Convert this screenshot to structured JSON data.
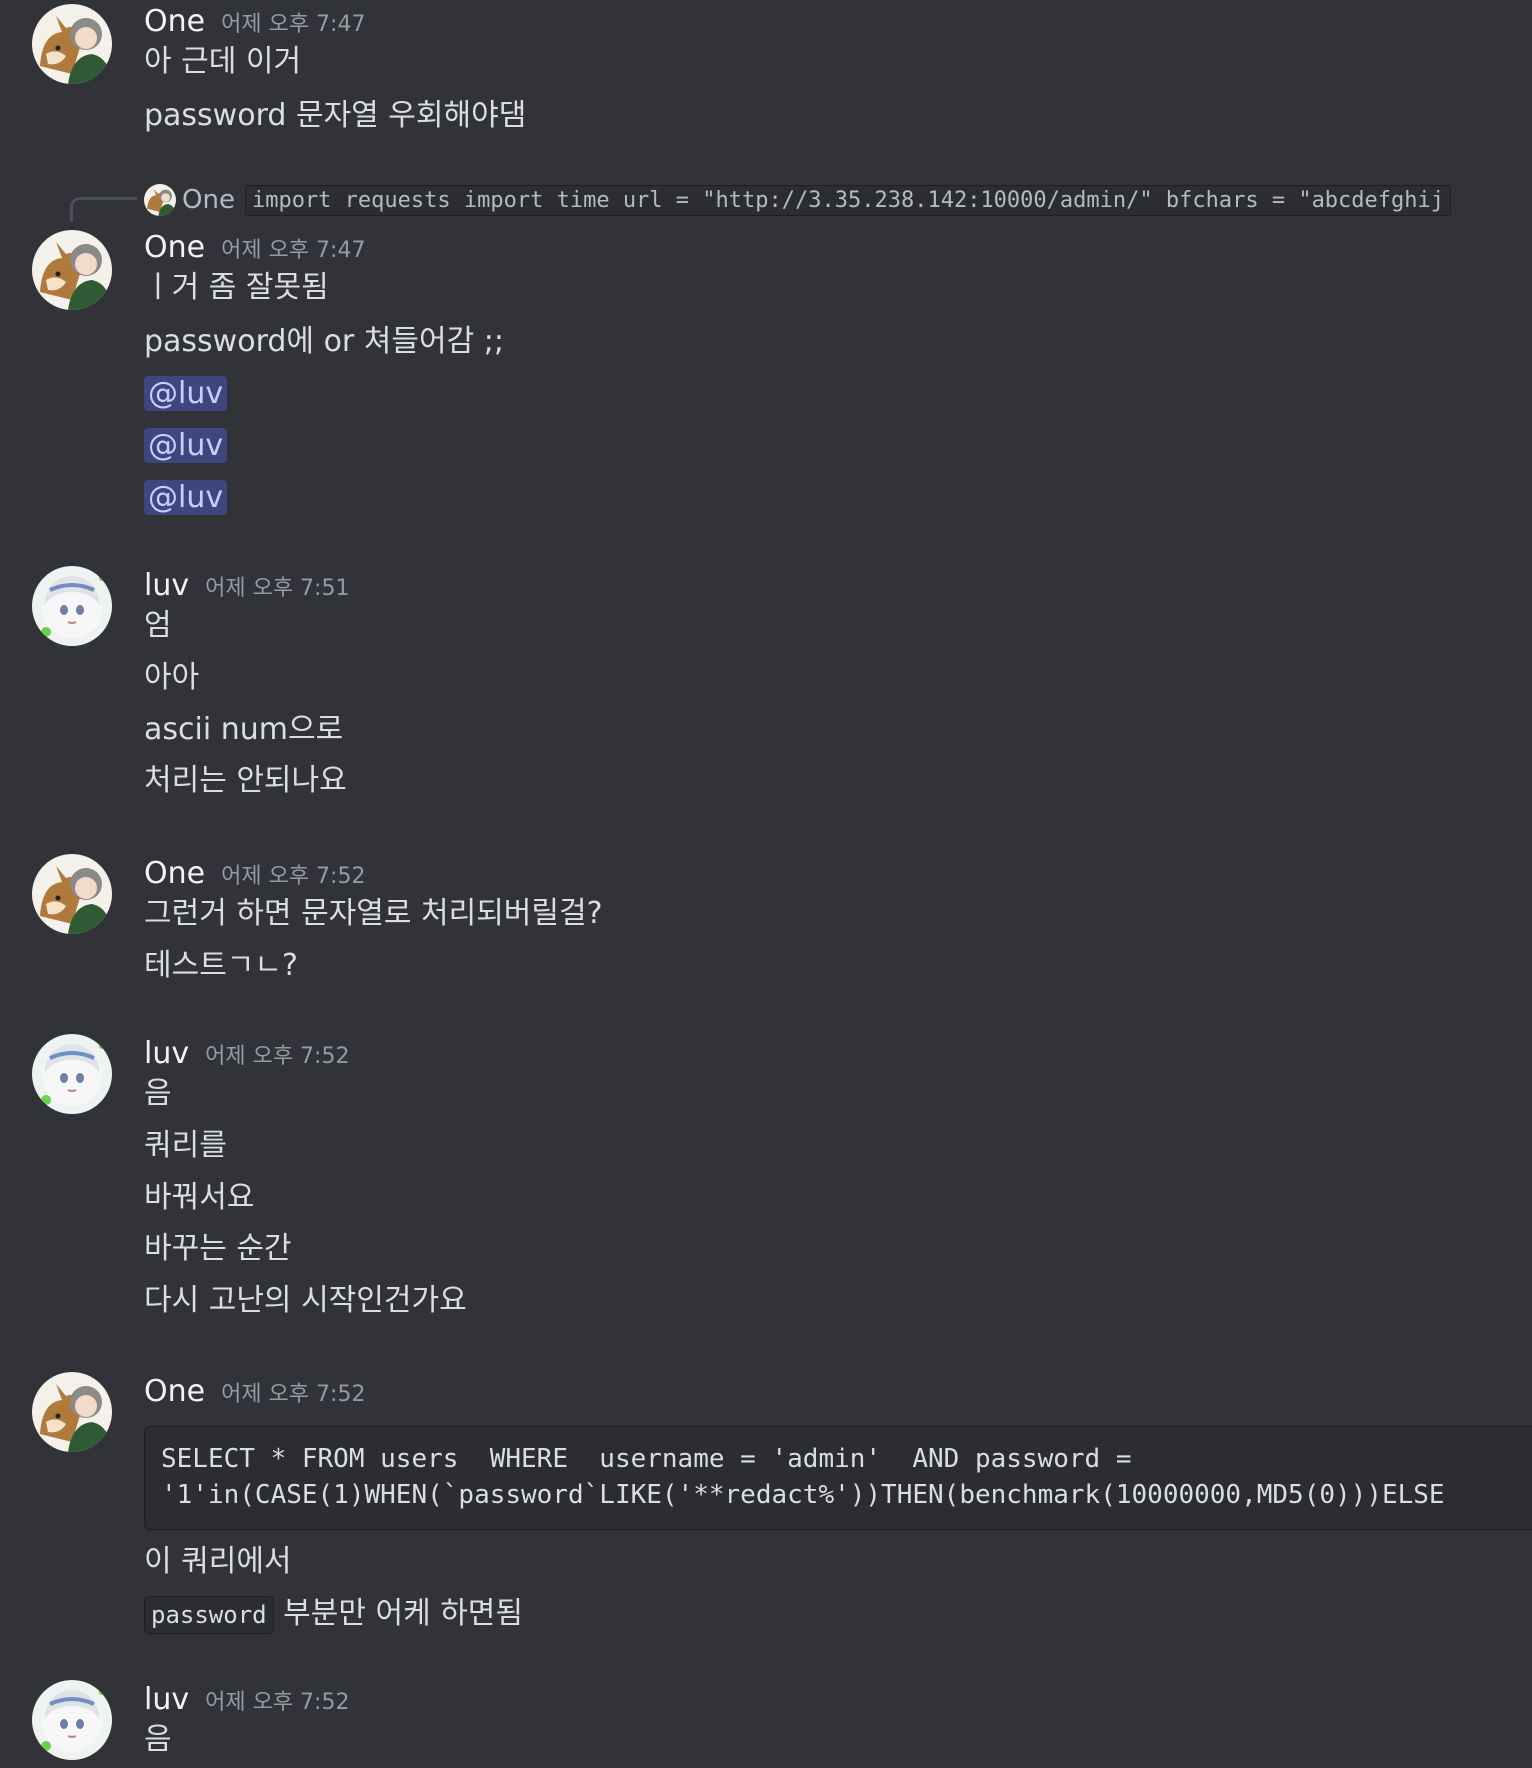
{
  "messages": [
    {
      "author": "One",
      "time": "어제 오후 7:47",
      "avatar": "one-avatar-icon",
      "lines": [
        "아 근데 이거",
        "password 문자열 우회해야댐"
      ]
    },
    {
      "reply": {
        "author": "One",
        "preview": "import requests import time url = \"http://3.35.238.142:10000/admin/\" bfchars = \"abcdefghij"
      },
      "author": "One",
      "time": "어제 오후 7:47",
      "lines": [
        "ㅣ거 좀 잘못됨",
        "password에 or 쳐들어감 ;;"
      ],
      "mentions": [
        "@luv",
        "@luv",
        "@luv"
      ]
    },
    {
      "author": "luv",
      "time": "어제 오후 7:51",
      "lines": [
        "엄",
        "아아",
        "ascii num으로",
        "처리는 안되나요"
      ]
    },
    {
      "author": "One",
      "time": "어제 오후 7:52",
      "lines": [
        "그런거 하면 문자열로 처리되버릴걸?",
        "테스트ㄱㄴ?"
      ]
    },
    {
      "author": "luv",
      "time": "어제 오후 7:52",
      "lines": [
        "음",
        "쿼리를",
        "바꿔서요",
        "바꾸는 순간",
        "다시 고난의 시작인건가요"
      ]
    },
    {
      "author": "One",
      "time": "어제 오후 7:52",
      "code_block": "SELECT * FROM users  WHERE  username = 'admin'  AND password =\n'1'in(CASE(1)WHEN(`password`LIKE('**redact%'))THEN(benchmark(10000000,MD5(0)))ELSE",
      "lines": [
        "이 쿼리에서"
      ],
      "inline_code": "password",
      "inline_suffix": " 부분만 어케 하면됨"
    },
    {
      "author": "luv",
      "time": "어제 오후 7:52",
      "lines": [
        "음"
      ]
    }
  ],
  "colors": {
    "background": "#313338",
    "username": "#f2f3f5",
    "timestamp": "#949ba4",
    "text": "#dbdee1",
    "mention_bg": "#5865f2"
  }
}
